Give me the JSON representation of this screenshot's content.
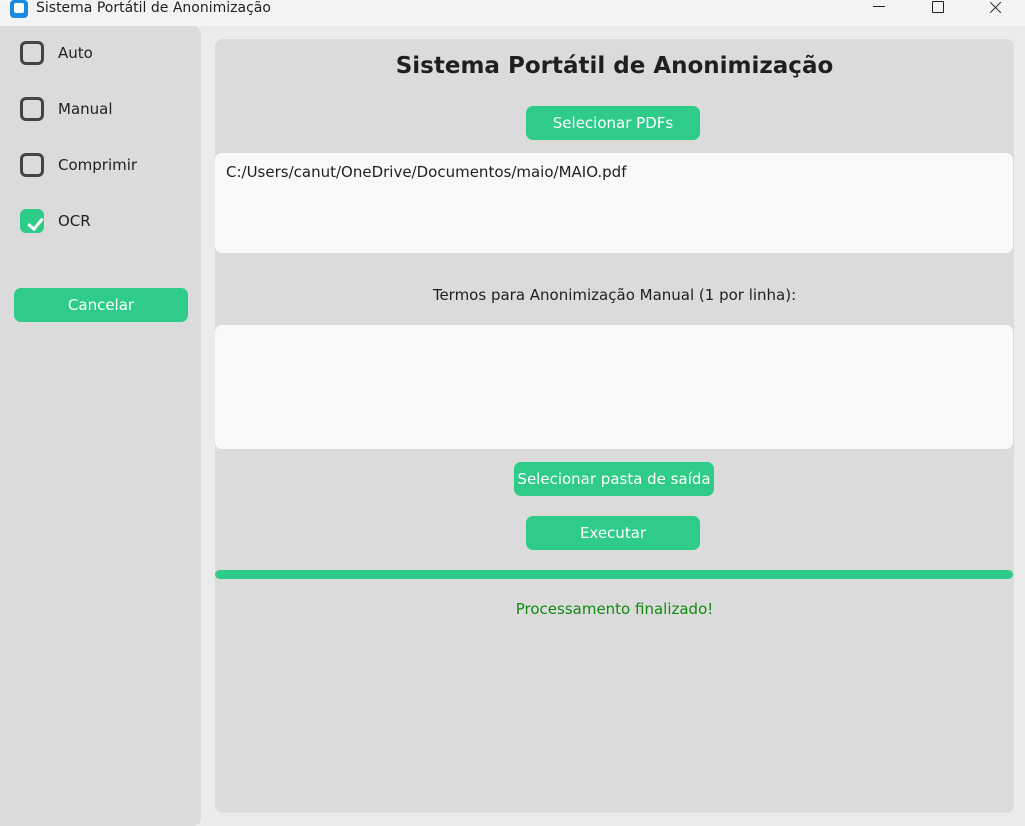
{
  "window": {
    "title": "Sistema Portátil de Anonimização"
  },
  "sidebar": {
    "options": [
      {
        "label": "Auto",
        "checked": false
      },
      {
        "label": "Manual",
        "checked": false
      },
      {
        "label": "Comprimir",
        "checked": false
      },
      {
        "label": "OCR",
        "checked": true
      }
    ],
    "cancel_label": "Cancelar"
  },
  "main": {
    "title": "Sistema Portátil de Anonimização",
    "select_pdfs_label": "Selecionar PDFs",
    "files_text": "C:/Users/canut/OneDrive/Documentos/maio/MAIO.pdf",
    "terms_label": "Termos para Anonimização Manual (1 por linha):",
    "terms_text": "",
    "select_output_label": "Selecionar pasta de saída",
    "execute_label": "Executar",
    "progress": 1.0,
    "status_text": "Processamento finalizado!"
  },
  "colors": {
    "accent": "#2ecc88",
    "status": "#118a11"
  }
}
